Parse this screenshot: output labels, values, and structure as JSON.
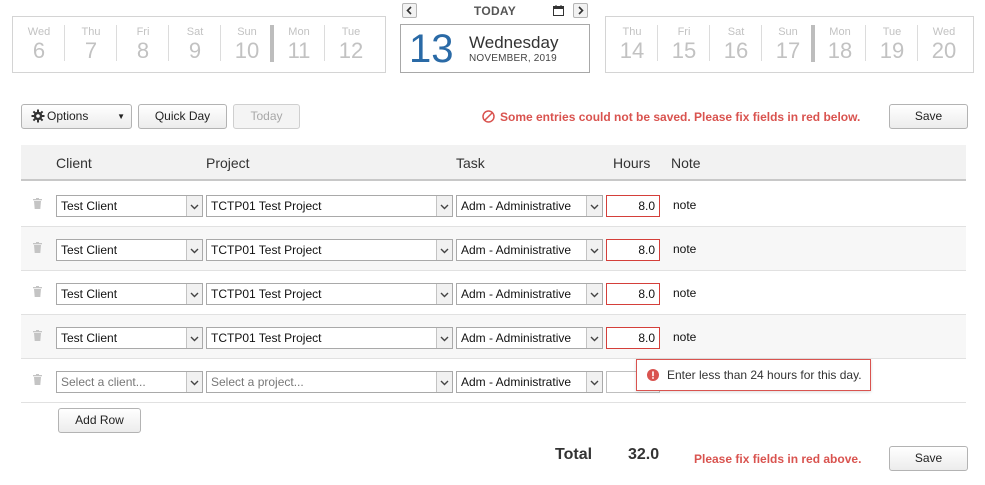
{
  "date_nav": {
    "today_label": "TODAY",
    "prev_icon": "chevron-left-icon",
    "next_icon": "chevron-right-icon",
    "calendar_icon": "calendar-icon",
    "previous_days": [
      {
        "name": "Wed",
        "num": "6"
      },
      {
        "name": "Thu",
        "num": "7"
      },
      {
        "name": "Fri",
        "num": "8"
      },
      {
        "name": "Sat",
        "num": "9"
      },
      {
        "name": "Sun",
        "num": "10"
      },
      {
        "name": "Mon",
        "num": "11"
      },
      {
        "name": "Tue",
        "num": "12"
      }
    ],
    "current": {
      "num": "13",
      "weekday": "Wednesday",
      "month_year": "NOVEMBER, 2019"
    },
    "next_days": [
      {
        "name": "Thu",
        "num": "14"
      },
      {
        "name": "Fri",
        "num": "15"
      },
      {
        "name": "Sat",
        "num": "16"
      },
      {
        "name": "Sun",
        "num": "17"
      },
      {
        "name": "Mon",
        "num": "18"
      },
      {
        "name": "Tue",
        "num": "19"
      },
      {
        "name": "Wed",
        "num": "20"
      }
    ]
  },
  "toolbar": {
    "options_label": "Options",
    "quick_day_label": "Quick Day",
    "today_label": "Today",
    "save_label": "Save",
    "error_message": "Some entries could not be saved. Please fix fields in red below."
  },
  "grid": {
    "headers": {
      "client": "Client",
      "project": "Project",
      "task": "Task",
      "hours": "Hours",
      "note": "Note"
    },
    "rows": [
      {
        "client": "Test Client",
        "project": "TCTP01 Test Project",
        "task": "Adm - Administrative",
        "hours": "8.0",
        "note": "note"
      },
      {
        "client": "Test Client",
        "project": "TCTP01 Test Project",
        "task": "Adm - Administrative",
        "hours": "8.0",
        "note": "note"
      },
      {
        "client": "Test Client",
        "project": "TCTP01 Test Project",
        "task": "Adm - Administrative",
        "hours": "8.0",
        "note": "note"
      },
      {
        "client": "Test Client",
        "project": "TCTP01 Test Project",
        "task": "Adm - Administrative",
        "hours": "8.0",
        "note": "note"
      }
    ],
    "new_row": {
      "client_placeholder": "Select a client...",
      "project_placeholder": "Select a project...",
      "task": "Adm - Administrative",
      "hours": ""
    },
    "tooltip": "Enter less than 24 hours for this day.",
    "add_row_label": "Add Row"
  },
  "footer": {
    "total_label": "Total",
    "total_value": "32.0",
    "error_message": "Please fix fields in red above.",
    "save_label": "Save"
  },
  "colors": {
    "error": "#d9534f",
    "current_day": "#2a6aa6"
  }
}
